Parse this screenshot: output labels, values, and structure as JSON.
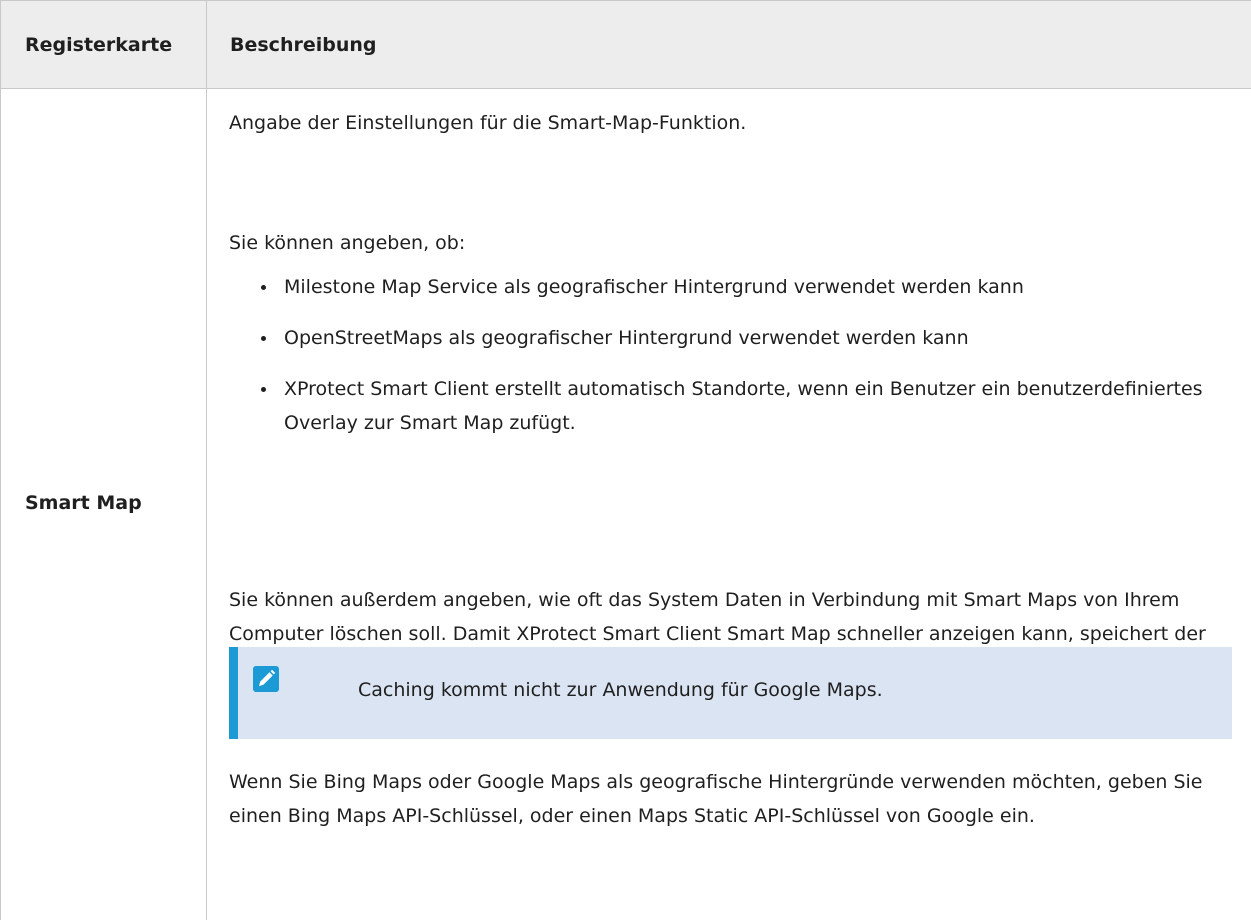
{
  "table": {
    "headers": [
      "Registerkarte",
      "Beschreibung"
    ],
    "row_label": "Smart Map",
    "intro": "Angabe der Einstellungen für die Smart-Map-Funktion.",
    "can_specify": "Sie können angeben, ob:",
    "bullets": [
      "Milestone Map Service als geografischer Hintergrund verwendet werden kann",
      "OpenStreetMaps als geografischer Hintergrund verwendet werden kann",
      "XProtect Smart Client erstellt automatisch Standorte, wenn ein Benutzer ein benutzerdefiniertes Overlay zur Smart Map zufügt."
    ],
    "also_specify": "Sie können außerdem angeben, wie oft das System Daten in Verbindung mit Smart Maps von Ihrem Computer löschen soll. Damit XProtect Smart Client Smart Map schneller anzeigen kann, speichert der Client die Kartendaten im Cache auf Ihrem Computer. Im Laufe der Zeit kann dies Ihren Computer verlangsamen.",
    "note": {
      "icon": "pencil-icon",
      "text": "Caching kommt nicht zur Anwendung für Google Maps."
    },
    "bing_google": "Wenn Sie Bing Maps oder Google Maps als geografische Hintergründe verwenden möchten, geben Sie einen Bing Maps API-Schlüssel, oder einen Maps Static API-Schlüssel von Google ein."
  },
  "colors": {
    "header_bg": "#ededed",
    "note_bg": "#dbe4f2",
    "accent": "#1c9ad6",
    "border": "#c9c9c9"
  }
}
